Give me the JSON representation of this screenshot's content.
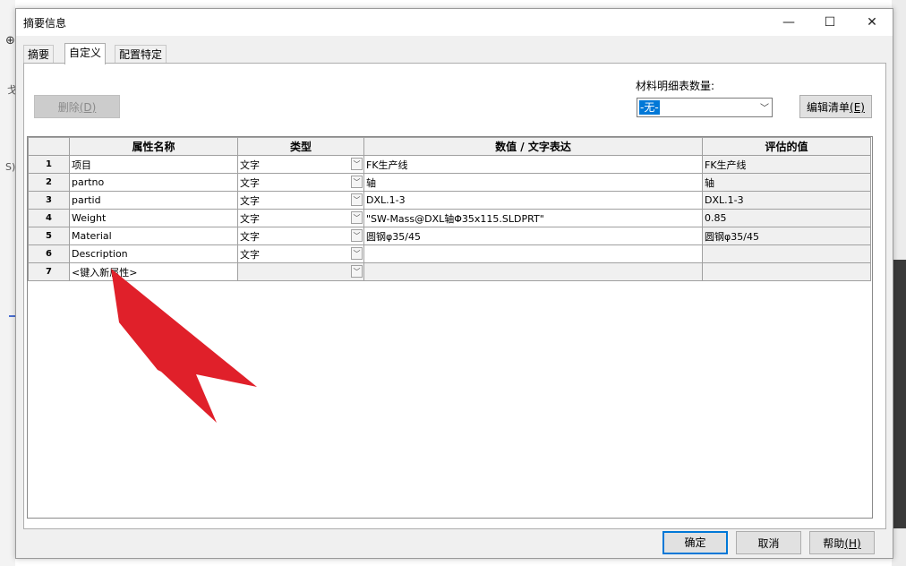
{
  "window": {
    "title": "摘要信息",
    "minimize": "—",
    "maximize": "☐",
    "close": "✕"
  },
  "tabs": [
    {
      "label": "摘要"
    },
    {
      "label": "自定义"
    },
    {
      "label": "配置特定"
    }
  ],
  "toolbar": {
    "delete_label": "删除",
    "delete_key": "(D)",
    "bom_quantity_label": "材料明细表数量:",
    "bom_quantity_value": "-无-",
    "edit_list_label": "编辑清单",
    "edit_list_key": "(E)"
  },
  "table": {
    "headers": [
      "",
      "属性名称",
      "类型",
      "数值 / 文字表达",
      "评估的值"
    ],
    "rows": [
      {
        "num": "1",
        "name": "项目",
        "type": "文字",
        "expr": "FK生产线",
        "value": "FK生产线"
      },
      {
        "num": "2",
        "name": "partno",
        "type": "文字",
        "expr": "轴",
        "value": "轴"
      },
      {
        "num": "3",
        "name": "partid",
        "type": "文字",
        "expr": "DXL.1-3",
        "value": "DXL.1-3"
      },
      {
        "num": "4",
        "name": "Weight",
        "type": "文字",
        "expr": "\"SW-Mass@DXL轴Φ35x115.SLDPRT\"",
        "value": "0.85"
      },
      {
        "num": "5",
        "name": "Material",
        "type": "文字",
        "expr": "圆钢φ35/45",
        "value": "圆钢φ35/45"
      },
      {
        "num": "6",
        "name": "Description",
        "type": "文字",
        "expr": "",
        "value": ""
      },
      {
        "num": "7",
        "name": "<键入新属性>",
        "type": "",
        "expr": "",
        "value": ""
      }
    ]
  },
  "footer": {
    "ok_label": "确定",
    "cancel_label": "取消",
    "help_label": "帮助",
    "help_key": "(H)"
  },
  "colors": {
    "accent": "#0078d7",
    "arrow": "#e0202a"
  }
}
